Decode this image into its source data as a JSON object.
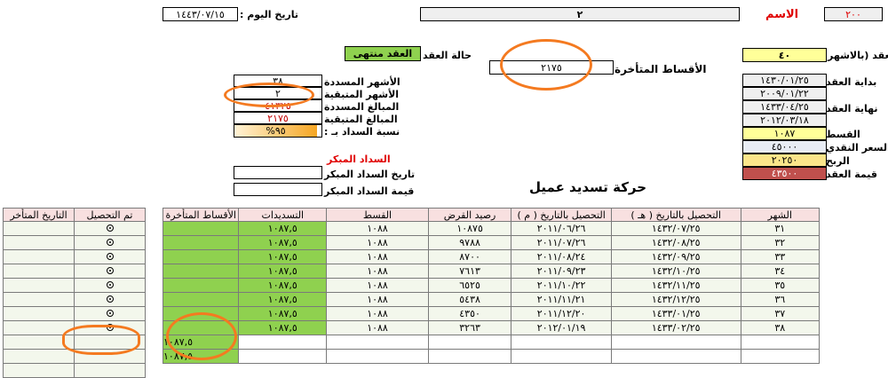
{
  "header": {
    "id_value": "٢٠٠",
    "name_label": "الاسم",
    "name_value": "٢",
    "today_label": "تاريخ اليوم :",
    "today_value": "١٤٤٣/٠٧/١٥"
  },
  "contract": {
    "duration_label": "دة العقد (بالاشهر",
    "duration_value": "٤٠",
    "status_label": "حالة العقد",
    "status_value": "العقد منتهى",
    "overdue_label": "الأقساط المتأخرة",
    "overdue_value": "٢١٧٥",
    "start_label": "بداية العقد",
    "start_hijri": "١٤٣٠/٠١/٢٥",
    "start_greg": "٢٠٠٩/٠١/٢٢",
    "end_label": "نهاية العقد",
    "end_hijri": "١٤٣٣/٠٤/٢٥",
    "end_greg": "٢٠١٢/٠٣/١٨",
    "installment_label": "القسط",
    "installment_value": "١٠٨٧",
    "cash_label": "السعر النقدي",
    "cash_value": "٤٥٠٠٠",
    "profit_label": "الربح",
    "profit_value": "٢٠٢٥٠",
    "total_label": "قيمة العقد",
    "total_value": "٤٣٥٠٠"
  },
  "summary": {
    "paid_months_label": "الأشهر المسددة",
    "paid_months_value": "٣٨",
    "remaining_months_label": "الأشهر المتبقية",
    "remaining_months_value": "٢",
    "paid_amount_label": "المبالغ المسددة",
    "paid_amount_value": "٤١٣٢٥",
    "remaining_amount_label": "المبالغ المتبقية",
    "remaining_amount_value": "٢١٧٥",
    "ratio_label": "نسبة السداد بـ :",
    "ratio_value": "%٩٥",
    "ratio_fraction": 0.95
  },
  "early": {
    "title": "السداد المبكر",
    "date_label": "تاريخ السداد المبكر",
    "date_value": "",
    "amount_label": "قيمة السداد المبكر",
    "amount_value": ""
  },
  "main_title": "حركة تسديد عميل",
  "table": {
    "headers": [
      "الشهر",
      "التحصيل بالتاريخ ( هـ )",
      "التحصيل بالتاريخ ( م )",
      "رصيد القرض",
      "القسط",
      "التسديدات",
      "الأقساط المتأخرة"
    ],
    "rows": [
      [
        "٣١",
        "١٤٣٢/٠٧/٢٥",
        "٢٠١١/٠٦/٢٦",
        "١٠٨٧٥",
        "١٠٨٨",
        "١٠٨٧,٥",
        ""
      ],
      [
        "٣٢",
        "١٤٣٢/٠٨/٢٥",
        "٢٠١١/٠٧/٢٦",
        "٩٧٨٨",
        "١٠٨٨",
        "١٠٨٧,٥",
        ""
      ],
      [
        "٣٣",
        "١٤٣٢/٠٩/٢٥",
        "٢٠١١/٠٨/٢٤",
        "٨٧٠٠",
        "١٠٨٨",
        "١٠٨٧,٥",
        ""
      ],
      [
        "٣٤",
        "١٤٣٢/١٠/٢٥",
        "٢٠١١/٠٩/٢٣",
        "٧٦١٣",
        "١٠٨٨",
        "١٠٨٧,٥",
        ""
      ],
      [
        "٣٥",
        "١٤٣٢/١١/٢٥",
        "٢٠١١/١٠/٢٢",
        "٦٥٢٥",
        "١٠٨٨",
        "١٠٨٧,٥",
        ""
      ],
      [
        "٣٦",
        "١٤٣٢/١٢/٢٥",
        "٢٠١١/١١/٢١",
        "٥٤٣٨",
        "١٠٨٨",
        "١٠٨٧,٥",
        ""
      ],
      [
        "٣٧",
        "١٤٣٣/٠١/٢٥",
        "٢٠١١/١٢/٢٠",
        "٤٣٥٠",
        "١٠٨٨",
        "١٠٨٧,٥",
        ""
      ],
      [
        "٣٨",
        "١٤٣٣/٠٢/٢٥",
        "٢٠١٢/٠١/١٩",
        "٣٢٦٣",
        "١٠٨٨",
        "١٠٨٧,٥",
        ""
      ],
      [
        "",
        "",
        "",
        "",
        "",
        "",
        "١٠٨٧,٥"
      ],
      [
        "",
        "",
        "",
        "",
        "",
        "",
        "١٠٨٧,٥"
      ]
    ]
  },
  "side_table": {
    "headers": [
      "تم التحصيل",
      "التاريخ المتأخر"
    ],
    "collected_rows": 8,
    "total_rows": 11
  }
}
